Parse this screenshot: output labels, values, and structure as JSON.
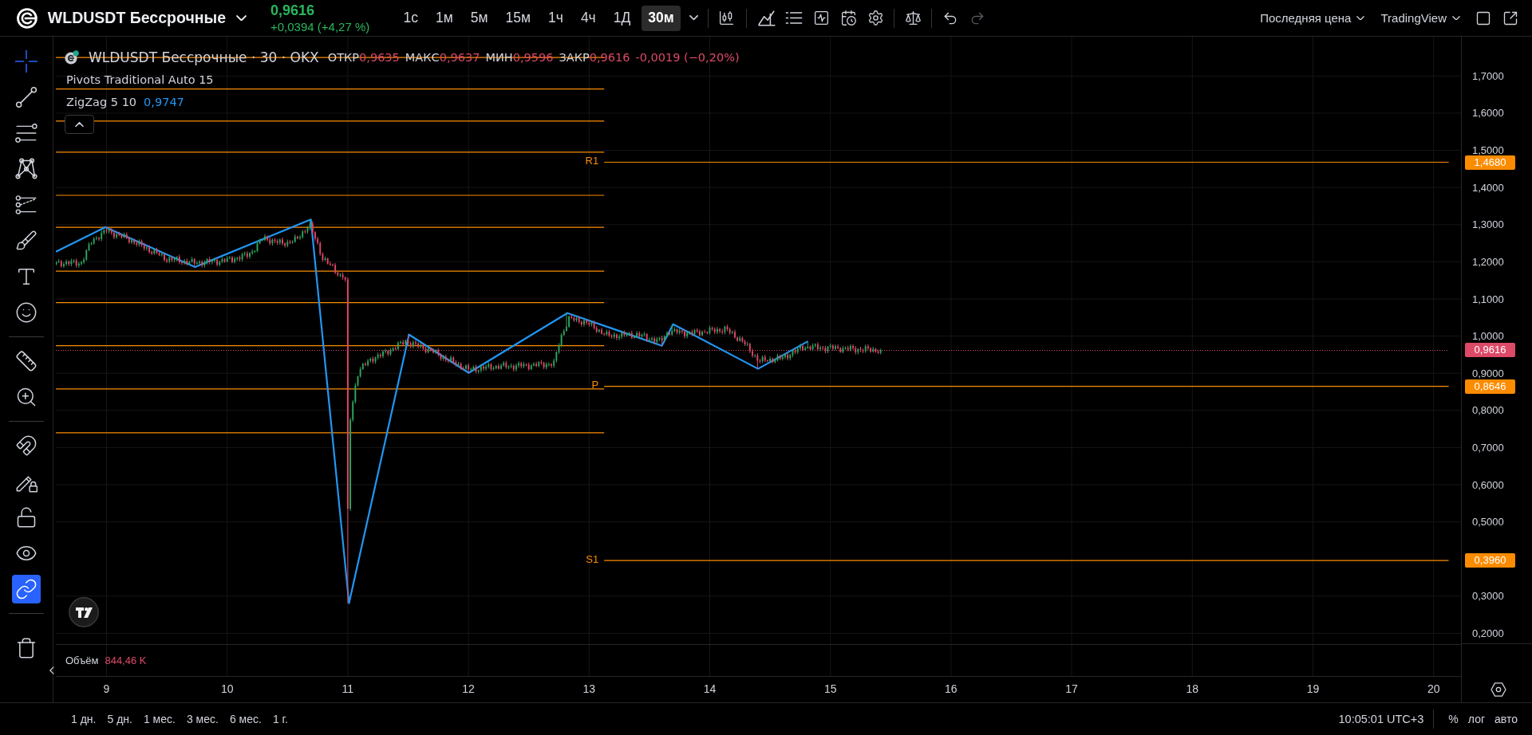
{
  "header": {
    "symbol": "WLDUSDT Бессрочные",
    "price": "0,9616",
    "change": "+0,0394 (+4,27 %)",
    "intervals": [
      {
        "label": "1с",
        "selected": false
      },
      {
        "label": "1м",
        "selected": false
      },
      {
        "label": "5м",
        "selected": false
      },
      {
        "label": "15м",
        "selected": false
      },
      {
        "label": "1ч",
        "selected": false
      },
      {
        "label": "4ч",
        "selected": false
      },
      {
        "label": "1Д",
        "selected": false
      },
      {
        "label": "30м",
        "selected": true
      }
    ],
    "history": [
      {
        "disabled": false
      },
      {
        "disabled": true
      }
    ],
    "price_source": "Последняя цена",
    "broker": "TradingView"
  },
  "left_toolbar": {
    "tool_groups": [
      {
        "tools": [
          {
            "selected": true
          },
          {
            "selected": false
          },
          {
            "selected": false
          },
          {
            "selected": false
          },
          {
            "selected": false
          },
          {
            "selected": false
          },
          {
            "selected": false
          },
          {
            "selected": false
          }
        ]
      },
      {
        "tools": [
          {
            "selected": false
          },
          {
            "selected": false
          }
        ]
      }
    ],
    "toggles": [
      {
        "on": false
      },
      {
        "on": false
      },
      {
        "on": false
      },
      {
        "on": false
      },
      {
        "on": true
      }
    ]
  },
  "chart": {
    "legend": {
      "title": "WLDUSDT Бессрочные · 30 · OKX",
      "ohlc": [
        {
          "label": "ОТКР",
          "value": "0,9635"
        },
        {
          "label": "МАКС",
          "value": "0,9637"
        },
        {
          "label": "МИН",
          "value": "0,9596"
        },
        {
          "label": "ЗАКР",
          "value": "0,9616"
        }
      ],
      "change": "-0,0019 (−0,20%)",
      "indicators": [
        {
          "name": "Pivots Traditional Auto 15"
        },
        {
          "name": "ZigZag 5 10",
          "value": "0,9747"
        }
      ]
    },
    "chart_data": {
      "type": "line",
      "grid": true,
      "x": [
        8.58,
        8.99,
        9.734,
        10.694,
        11.01,
        11.507,
        12.003,
        12.82,
        13.125,
        13.603,
        13.697,
        14.4,
        14.814,
        20.125
      ],
      "series": [
        {
          "color": "#fb8c00",
          "values": [
            1.75,
            1.75,
            1.75,
            1.75,
            1.75,
            1.75,
            1.75,
            1.75,
            1.75,
            null,
            null,
            null,
            null,
            null
          ]
        },
        {
          "color": "#fb8c00",
          "values": [
            1.665,
            1.665,
            1.665,
            1.665,
            1.665,
            1.665,
            1.665,
            1.665,
            1.665,
            null,
            null,
            null,
            null,
            null
          ]
        },
        {
          "color": "#fb8c00",
          "values": [
            1.579,
            1.579,
            1.579,
            1.579,
            1.579,
            1.579,
            1.579,
            1.579,
            1.579,
            null,
            null,
            null,
            null,
            null
          ]
        },
        {
          "color": "#fb8c00",
          "values": [
            1.495,
            1.495,
            1.495,
            1.495,
            1.495,
            1.495,
            1.495,
            1.495,
            1.495,
            null,
            null,
            null,
            null,
            null
          ]
        },
        {
          "color": "#fb8c00",
          "values": [
            1.379,
            1.379,
            1.379,
            1.379,
            1.379,
            1.379,
            1.379,
            1.379,
            1.379,
            null,
            null,
            null,
            null,
            null
          ]
        },
        {
          "color": "#fb8c00",
          "values": [
            1.293,
            1.293,
            1.293,
            1.293,
            1.293,
            1.293,
            1.293,
            1.293,
            1.293,
            null,
            null,
            null,
            null,
            null
          ]
        },
        {
          "color": "#fb8c00",
          "values": [
            1.175,
            1.175,
            1.175,
            1.175,
            1.175,
            1.175,
            1.175,
            1.175,
            1.175,
            null,
            null,
            null,
            null,
            null
          ]
        },
        {
          "color": "#fb8c00",
          "values": [
            1.09,
            1.09,
            1.09,
            1.09,
            1.09,
            1.09,
            1.09,
            1.09,
            1.09,
            null,
            null,
            null,
            null,
            null
          ]
        },
        {
          "color": "#fb8c00",
          "values": [
            0.974,
            0.974,
            0.974,
            0.974,
            0.974,
            0.974,
            0.974,
            0.974,
            0.974,
            null,
            null,
            null,
            null,
            null
          ]
        },
        {
          "color": "#fb8c00",
          "values": [
            0.858,
            0.858,
            0.858,
            0.858,
            0.858,
            0.858,
            0.858,
            0.858,
            0.858,
            null,
            null,
            null,
            null,
            null
          ]
        },
        {
          "color": "#fb8c00",
          "values": [
            0.74,
            0.74,
            0.74,
            0.74,
            0.74,
            0.74,
            0.74,
            0.74,
            0.74,
            null,
            null,
            null,
            null,
            null
          ]
        },
        {
          "name": "R1",
          "color": "#fb8c00",
          "values": [
            null,
            null,
            null,
            null,
            null,
            null,
            null,
            null,
            1.468,
            1.468,
            1.468,
            1.468,
            1.468,
            1.468
          ]
        },
        {
          "name": "P",
          "color": "#fb8c00",
          "values": [
            null,
            null,
            null,
            null,
            null,
            null,
            null,
            null,
            0.8646,
            0.8646,
            0.8646,
            0.8646,
            0.8646,
            0.8646
          ]
        },
        {
          "name": "S1",
          "color": "#fb8c00",
          "values": [
            null,
            null,
            null,
            null,
            null,
            null,
            null,
            null,
            0.396,
            0.396,
            0.396,
            0.396,
            0.396,
            0.396
          ]
        },
        {
          "color": "#dd4a68",
          "line_style": "dotted",
          "values": [
            0.9616,
            0.9616,
            0.9616,
            0.9616,
            0.9616,
            0.9616,
            0.9616,
            0.9616,
            0.9616,
            0.9616,
            0.9616,
            0.9616,
            0.9616,
            0.9616
          ]
        },
        {
          "color": "#2196f3",
          "values": [
            1.227,
            1.293,
            1.186,
            1.314,
            0.281,
            1.004,
            0.901,
            1.062,
            1.028,
            0.974,
            1.032,
            0.912,
            0.986,
            null
          ]
        }
      ],
      "xlim": [
        8.58,
        20.227
      ],
      "ylim": [
        0.085,
        1.806
      ],
      "xticks": [
        {
          "value": 9,
          "label": "9"
        },
        {
          "value": 10,
          "label": "10"
        },
        {
          "value": 11,
          "label": "11"
        },
        {
          "value": 12,
          "label": "12"
        },
        {
          "value": 13,
          "label": "13"
        },
        {
          "value": 14,
          "label": "14"
        },
        {
          "value": 15,
          "label": "15"
        },
        {
          "value": 16,
          "label": "16"
        },
        {
          "value": 17,
          "label": "17"
        },
        {
          "value": 18,
          "label": "18"
        },
        {
          "value": 19,
          "label": "19"
        },
        {
          "value": 20,
          "label": "20"
        }
      ],
      "yticks": [
        {
          "value": 0.2,
          "label": "0,2000"
        },
        {
          "value": 0.3,
          "label": "0,3000"
        },
        {
          "value": 0.396,
          "label": "0,3960"
        },
        {
          "value": 0.5,
          "label": "0,5000"
        },
        {
          "value": 0.6,
          "label": "0,6000"
        },
        {
          "value": 0.7,
          "label": "0,7000"
        },
        {
          "value": 0.8,
          "label": "0,8000"
        },
        {
          "value": 0.8646,
          "label": "0,8646"
        },
        {
          "value": 0.9,
          "label": "0,9000"
        },
        {
          "value": 0.9616,
          "label": "0,9616"
        },
        {
          "value": 1.0,
          "label": "1,0000"
        },
        {
          "value": 1.1,
          "label": "1,1000"
        },
        {
          "value": 1.2,
          "label": "1,2000"
        },
        {
          "value": 1.3,
          "label": "1,3000"
        },
        {
          "value": 1.4,
          "label": "1,4000"
        },
        {
          "value": 1.468,
          "label": "1,4680"
        },
        {
          "value": 1.5,
          "label": "1,5000"
        },
        {
          "value": 1.6,
          "label": "1,6000"
        },
        {
          "value": 1.7,
          "label": "1,7000"
        }
      ]
    },
    "volume": {
      "label": "Объём",
      "value": "844,46 K"
    }
  },
  "bottom_bar": {
    "ranges": [
      {
        "label": "1 дн.",
        "selected": false
      },
      {
        "label": "5 дн.",
        "selected": false
      },
      {
        "label": "1 мес.",
        "selected": false
      },
      {
        "label": "3 мес.",
        "selected": false
      },
      {
        "label": "6 мес.",
        "selected": false
      },
      {
        "label": "1 г.",
        "selected": false
      }
    ],
    "clock": "10:05:01 UTC+3",
    "scale_options": [
      {
        "label": "%",
        "on": false
      },
      {
        "label": "лог",
        "on": false
      },
      {
        "label": "авто",
        "on": false
      }
    ]
  }
}
